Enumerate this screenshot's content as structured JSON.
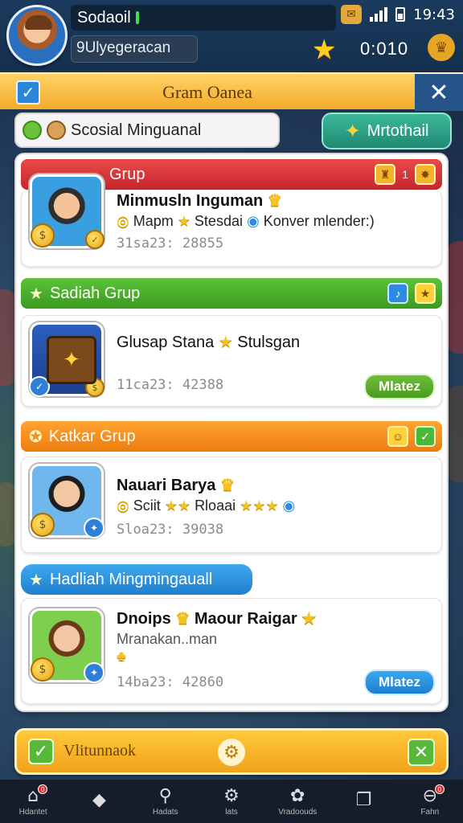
{
  "colors": {
    "accent_orange": "#f3ab2a",
    "teal_button": "#1f8a74",
    "group_red": "#c6262b",
    "group_green": "#3a9a1e",
    "group_orange": "#ed7c10",
    "group_blue": "#1f7fcd"
  },
  "status_bar": {
    "app_name": "Sodaoil",
    "time": "19:43",
    "notification_icon": "chat-bubble-icon"
  },
  "profile": {
    "username": "9Ulyegeracan",
    "score": "0:010",
    "star_icon": "star-icon",
    "crown_icon": "crown-icon"
  },
  "title_bar": {
    "title": "Gram Oanea"
  },
  "search": {
    "label": "Scosial Minguanal"
  },
  "find_button": {
    "label": "Mrtothail"
  },
  "sections": [
    {
      "header": "Grup",
      "count": "1",
      "card": {
        "title": "Minmusln Inguman",
        "sub": "Mapm",
        "sub2": "Stesdai",
        "sub3": "Konver mlender:)",
        "meta": "31sa23: 28855"
      }
    },
    {
      "header": "Sadiah Grup",
      "card": {
        "title": "Glusap Stana",
        "sub": "Stulsgan",
        "meta": "11ca23: 42388",
        "button": "Mlatez"
      }
    },
    {
      "header": "Katkar Grup",
      "card": {
        "title": "Nauari Barya",
        "sub": "Sciit",
        "sub2": "Rloaai",
        "meta": "Sloa23: 39038"
      }
    },
    {
      "header": "Hadliah Mingmingauall",
      "card": {
        "title": "Dnoips",
        "title2": "Maour Raigar",
        "sub": "Mranakan..man",
        "meta": "14ba23: 42860",
        "button": "Mlatez"
      }
    }
  ],
  "bottom_bar": {
    "label": "Vlitunnaok"
  },
  "nav": [
    {
      "label": "Hdantet",
      "icon": "home-icon",
      "badge": "0"
    },
    {
      "label": "",
      "icon": "diamond-icon"
    },
    {
      "label": "Hadats",
      "icon": "search-icon"
    },
    {
      "label": "lats",
      "icon": "gear-icon"
    },
    {
      "label": "Vradoouds",
      "icon": "settings-cog-icon"
    },
    {
      "label": "",
      "icon": "window-icon"
    },
    {
      "label": "Fahn",
      "icon": "minus-circle-icon",
      "badge": "0"
    }
  ]
}
